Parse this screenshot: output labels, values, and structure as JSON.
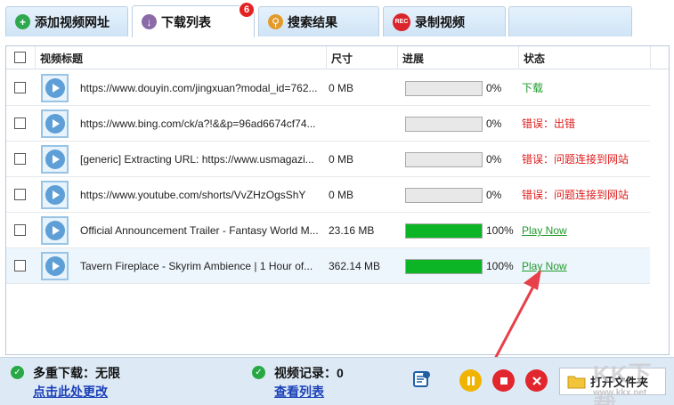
{
  "tabs": [
    {
      "label": "添加视频网址",
      "icon": "plus-icon",
      "color": "#2fa84f"
    },
    {
      "label": "下载列表",
      "icon": "download-icon",
      "color": "#8a6ba8"
    },
    {
      "label": "搜索结果",
      "icon": "search-icon",
      "color": "#e49a2a"
    },
    {
      "label": "录制视频",
      "icon": "rec-icon",
      "color": "#d9252b",
      "icon_text": "REC"
    }
  ],
  "badge_count": "6",
  "columns": [
    "视频标题",
    "尺寸",
    "进展",
    "状态"
  ],
  "rows": [
    {
      "title": "https://www.douyin.com/jingxuan?modal_id=762...",
      "size": "0 MB",
      "progress": 0,
      "pct": "0%",
      "status": "下载",
      "status_color": "#1f9a2b",
      "link": false
    },
    {
      "title": "https://www.bing.com/ck/a?!&&p=96ad6674cf74...",
      "size": "",
      "progress": 0,
      "pct": "0%",
      "status": "错误：出错",
      "status_color": "#e01b1b",
      "link": false
    },
    {
      "title": "[generic] Extracting URL: https://www.usmagazi...",
      "size": "0 MB",
      "progress": 0,
      "pct": "0%",
      "status": "错误：问题连接到网站",
      "status_color": "#e01b1b",
      "link": false
    },
    {
      "title": "https://www.youtube.com/shorts/VvZHzOgsShY",
      "size": "0 MB",
      "progress": 0,
      "pct": "0%",
      "status": "错误：问题连接到网站",
      "status_color": "#e01b1b",
      "link": false
    },
    {
      "title": "Official Announcement Trailer - Fantasy World M...",
      "size": "23.16 MB",
      "progress": 100,
      "pct": "100%",
      "status": "Play Now",
      "status_color": "#1f9a2b",
      "link": true
    },
    {
      "title": "Tavern Fireplace - Skyrim Ambience | 1 Hour of...",
      "size": "362.14 MB",
      "progress": 100,
      "pct": "100%",
      "status": "Play Now",
      "status_color": "#1f9a2b",
      "link": true
    }
  ],
  "footer": {
    "multi_label": "多重下载：无限",
    "change_link": "点击此处更改",
    "history_label": "视频记录：0",
    "view_link": "查看列表",
    "open_folder": "打开文件夹"
  },
  "watermark": {
    "text": "KK下载",
    "url": "www.kkx.net"
  },
  "colors": {
    "accent_green": "#0cb525",
    "error_red": "#e01b1b",
    "link_blue": "#1a3fb8",
    "arrow_red": "#e8404a"
  }
}
